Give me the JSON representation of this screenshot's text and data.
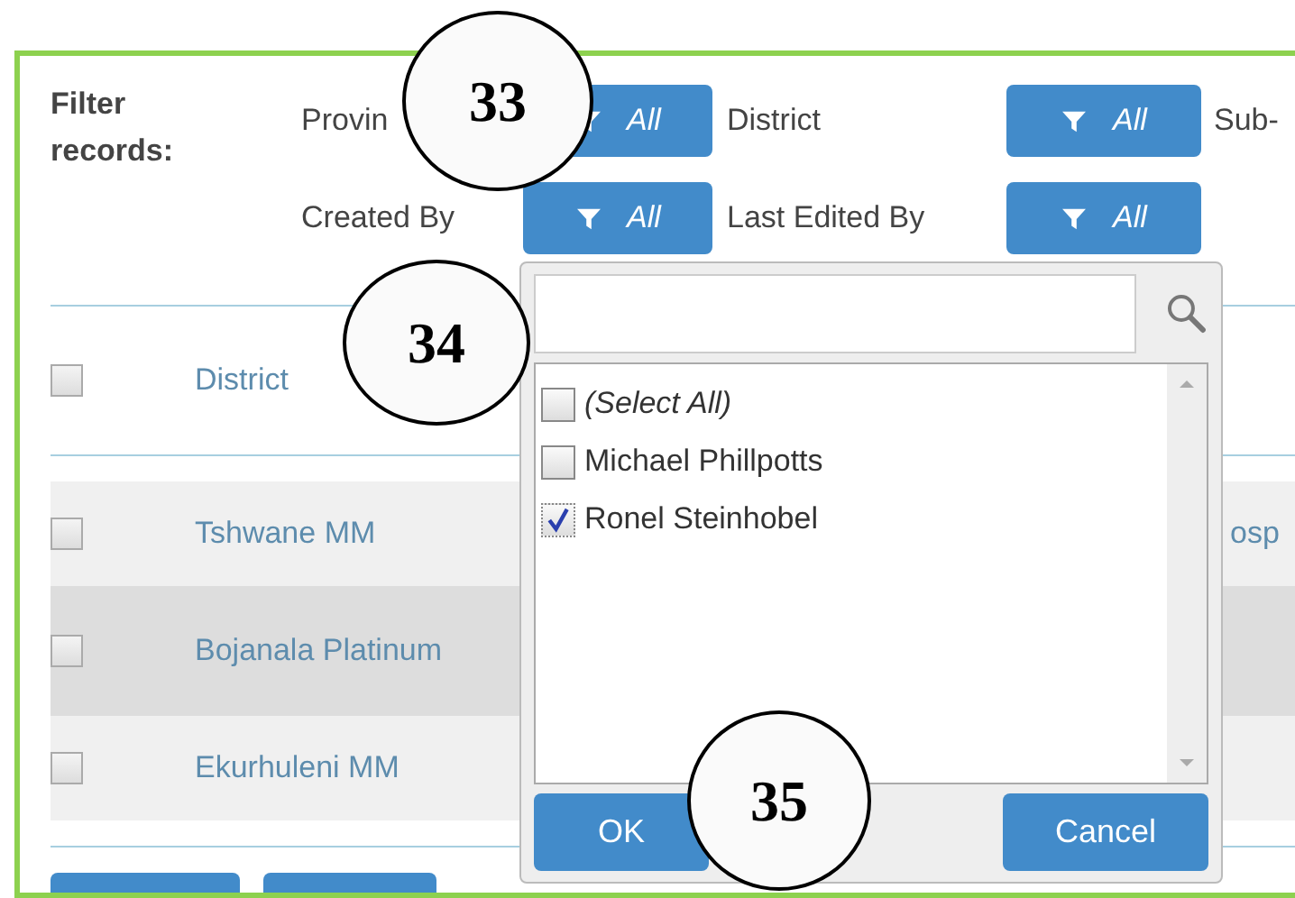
{
  "filter": {
    "label": "Filter records:",
    "rows": [
      [
        {
          "kind": "label",
          "text": "Provin"
        },
        {
          "kind": "filter",
          "text": "All"
        },
        {
          "kind": "label",
          "text": "District"
        },
        {
          "kind": "filter",
          "text": "All"
        },
        {
          "kind": "label",
          "text": "Sub-"
        }
      ],
      [
        {
          "kind": "label",
          "text": "Created By"
        },
        {
          "kind": "filter",
          "text": "All"
        },
        {
          "kind": "label",
          "text": "Last Edited By"
        },
        {
          "kind": "filter",
          "text": "All"
        }
      ]
    ]
  },
  "table": {
    "header": {
      "checked": false,
      "district": "District"
    },
    "rows": [
      {
        "checked": false,
        "highlighted": false,
        "district": "Tshwane MM",
        "column_3": "osp"
      },
      {
        "checked": false,
        "highlighted": true,
        "district": "Bojanala Platinum"
      },
      {
        "checked": false,
        "highlighted": false,
        "district": "Ekurhuleni MM"
      }
    ],
    "bottom_buttons": [
      {
        "kind": "action"
      },
      {
        "kind": "action"
      }
    ]
  },
  "popup": {
    "items": [
      {
        "label": "(Select All)",
        "italic": true,
        "checked": false
      },
      {
        "label": "Michael Phillpotts",
        "italic": false,
        "checked": false
      },
      {
        "label": "Ronel Steinhobel",
        "italic": false,
        "checked": true
      }
    ],
    "ok": "OK",
    "cancel": "Cancel"
  },
  "callouts": [
    "33",
    "34",
    "35"
  ]
}
